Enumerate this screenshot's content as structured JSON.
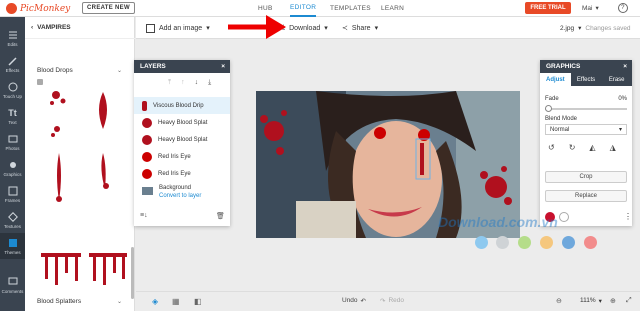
{
  "app": {
    "logo_text": "PicMonkey",
    "create_label": "CREATE NEW",
    "free_trial_label": "FREE TRIAL",
    "user_name": "Mai"
  },
  "nav": [
    {
      "label": "HUB"
    },
    {
      "label": "EDITOR"
    },
    {
      "label": "TEMPLATES"
    },
    {
      "label": "LEARN"
    }
  ],
  "rail": [
    {
      "label": "Edits"
    },
    {
      "label": "Effects"
    },
    {
      "label": "Touch Up"
    },
    {
      "label": "Text"
    },
    {
      "label": "Photos"
    },
    {
      "label": "Graphics"
    },
    {
      "label": "Frames"
    },
    {
      "label": "Textures"
    },
    {
      "label": "Themes"
    },
    {
      "label": "Comments"
    }
  ],
  "subpanel": {
    "back_label": "VAMPIRES",
    "section1": "Blood Drops",
    "section2": "Blood Splatters"
  },
  "toolbar": {
    "add_image": "Add an image",
    "download": "Download",
    "share": "Share",
    "filename": "2.jpg",
    "status": "Changes saved"
  },
  "layers": {
    "title": "LAYERS",
    "items": [
      {
        "label": "Viscous Blood Drip"
      },
      {
        "label": "Heavy Blood Splat"
      },
      {
        "label": "Heavy Blood Splat"
      },
      {
        "label": "Red Iris Eye"
      },
      {
        "label": "Red Iris Eye"
      }
    ],
    "background": {
      "label": "Background",
      "link": "Convert to layer"
    }
  },
  "graphics": {
    "title": "GRAPHICS",
    "tabs": [
      {
        "label": "Adjust"
      },
      {
        "label": "Effects"
      },
      {
        "label": "Erase"
      }
    ],
    "fade_label": "Fade",
    "fade_value": "0%",
    "blend_label": "Blend Mode",
    "blend_value": "Normal",
    "crop_label": "Crop",
    "replace_label": "Replace",
    "swatch_color": "#c8102e"
  },
  "bottom": {
    "undo": "Undo",
    "redo": "Redo",
    "zoom": "111%"
  },
  "watermark": {
    "text": "Download.com.vn"
  },
  "colors": {
    "accent": "#1c8ad1",
    "brand": "#e84a27",
    "rail": "#3a4450",
    "blood": "#b0101e"
  }
}
